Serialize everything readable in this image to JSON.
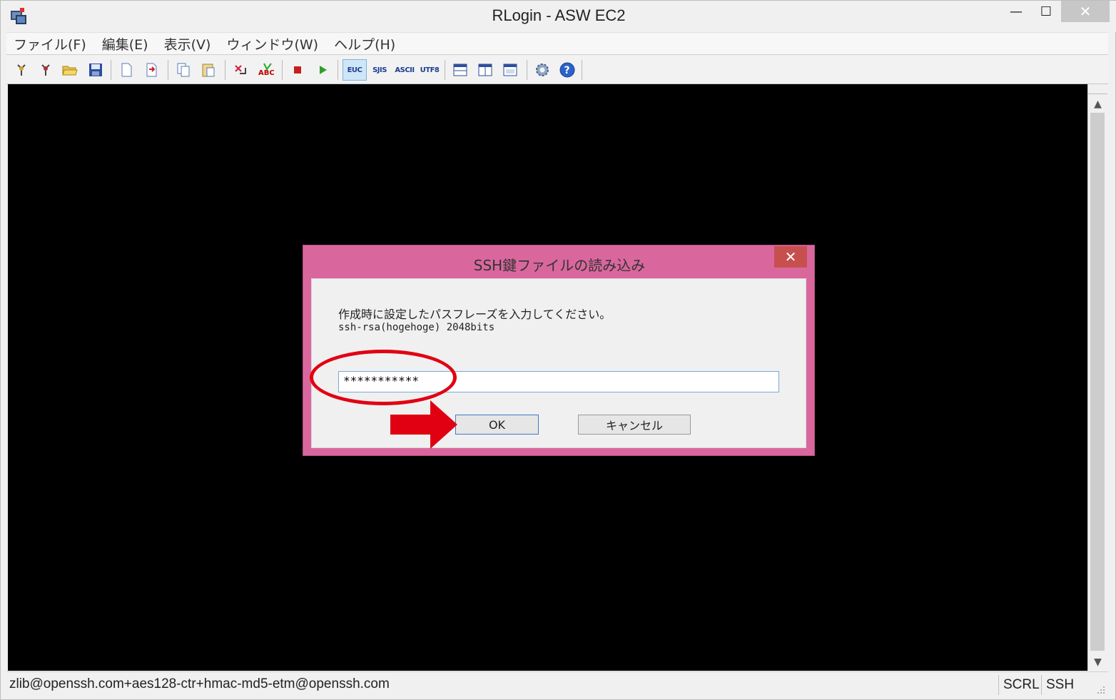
{
  "window": {
    "title": "RLogin - ASW EC2",
    "controls": {
      "minimize": "—",
      "maximize": "☐",
      "close": "✕"
    }
  },
  "menu": [
    "ファイル(F)",
    "編集(E)",
    "表示(V)",
    "ウィンドウ(W)",
    "ヘルプ(H)"
  ],
  "toolbar": {
    "encodings": [
      "EUC",
      "SJIS",
      "ASCII",
      "UTF8"
    ],
    "active_encoding": "EUC"
  },
  "dialog": {
    "title": "SSH鍵ファイルの読み込み",
    "close": "✕",
    "message": "作成時に設定したパスフレーズを入力してください。",
    "key_info": "ssh-rsa(hogehoge) 2048bits",
    "passphrase_value": "***********",
    "ok_label": "OK",
    "cancel_label": "キャンセル"
  },
  "statusbar": {
    "connection": "zlib@openssh.com+aes128-ctr+hmac-md5-etm@openssh.com",
    "scrl": "SCRL",
    "protocol": "SSH"
  },
  "colors": {
    "dialog_frame": "#d9679e",
    "annotation_red": "#e10012",
    "terminal_bg": "#000000"
  }
}
